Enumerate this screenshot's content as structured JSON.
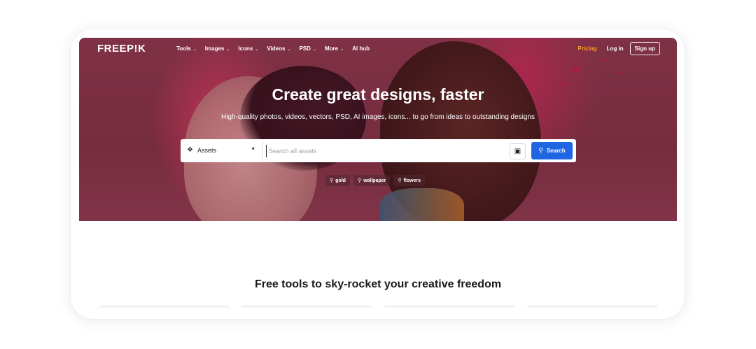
{
  "brand": {
    "logo_text": "FREEP!K"
  },
  "nav": {
    "items": [
      {
        "label": "Tools",
        "has_dropdown": true
      },
      {
        "label": "Images",
        "has_dropdown": true
      },
      {
        "label": "Icons",
        "has_dropdown": true
      },
      {
        "label": "Videos",
        "has_dropdown": true
      },
      {
        "label": "PSD",
        "has_dropdown": true
      },
      {
        "label": "More",
        "has_dropdown": true
      },
      {
        "label": "AI hub",
        "has_dropdown": false
      }
    ],
    "pricing_label": "Pricing",
    "login_label": "Log in",
    "signup_label": "Sign up"
  },
  "hero": {
    "headline": "Create great designs, faster",
    "subline": "High-quality photos, videos, vectors, PSD, AI images, icons... to go from ideas to outstanding designs"
  },
  "search": {
    "asset_type_selected": "Assets",
    "placeholder": "Search all assets",
    "value": "",
    "button_label": "Search"
  },
  "suggestions": [
    "gold",
    "wallpaper",
    "flowers"
  ],
  "section": {
    "title": "Free tools to sky-rocket your creative freedom"
  },
  "colors": {
    "accent_blue": "#1f66e5",
    "pricing_orange": "#f5a623",
    "hero_background": "#8a3a4f"
  },
  "icons": {
    "asset_type": "assets-stack-icon",
    "visual_search": "visual-search-icon",
    "search": "search-icon",
    "dropdown": "chevron-down-icon"
  }
}
